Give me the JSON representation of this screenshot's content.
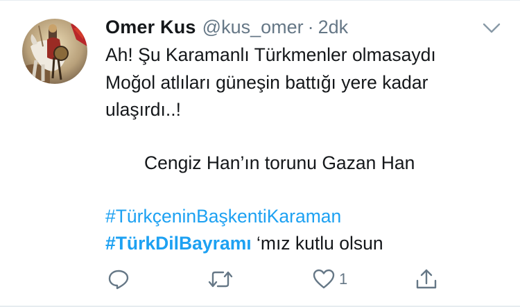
{
  "tweet": {
    "author_name": "Omer Kus",
    "handle": "@kus_omer",
    "separator": "·",
    "time": "2dk",
    "lines": [
      "Ah! Şu Karamanlı Türkmenler olmasaydı",
      "Moğol atlıları güneşin battığı yere kadar",
      "ulaşırdı..!",
      "Cengiz Han’ın torunu Gazan Han"
    ],
    "hashtag1": "#TürkçeninBaşkentiKaraman",
    "hashtag2": "#TürkDilBayramı",
    "hashtag2_suffix": " ‘mız kutlu olsun"
  },
  "actions": {
    "reply_icon": "reply-icon",
    "retweet_icon": "retweet-icon",
    "like_icon": "heart-icon",
    "like_count": "1",
    "share_icon": "share-icon"
  },
  "colors": {
    "text": "#14171a",
    "secondary": "#657786",
    "link": "#1da1f2",
    "icon": "#657786"
  }
}
